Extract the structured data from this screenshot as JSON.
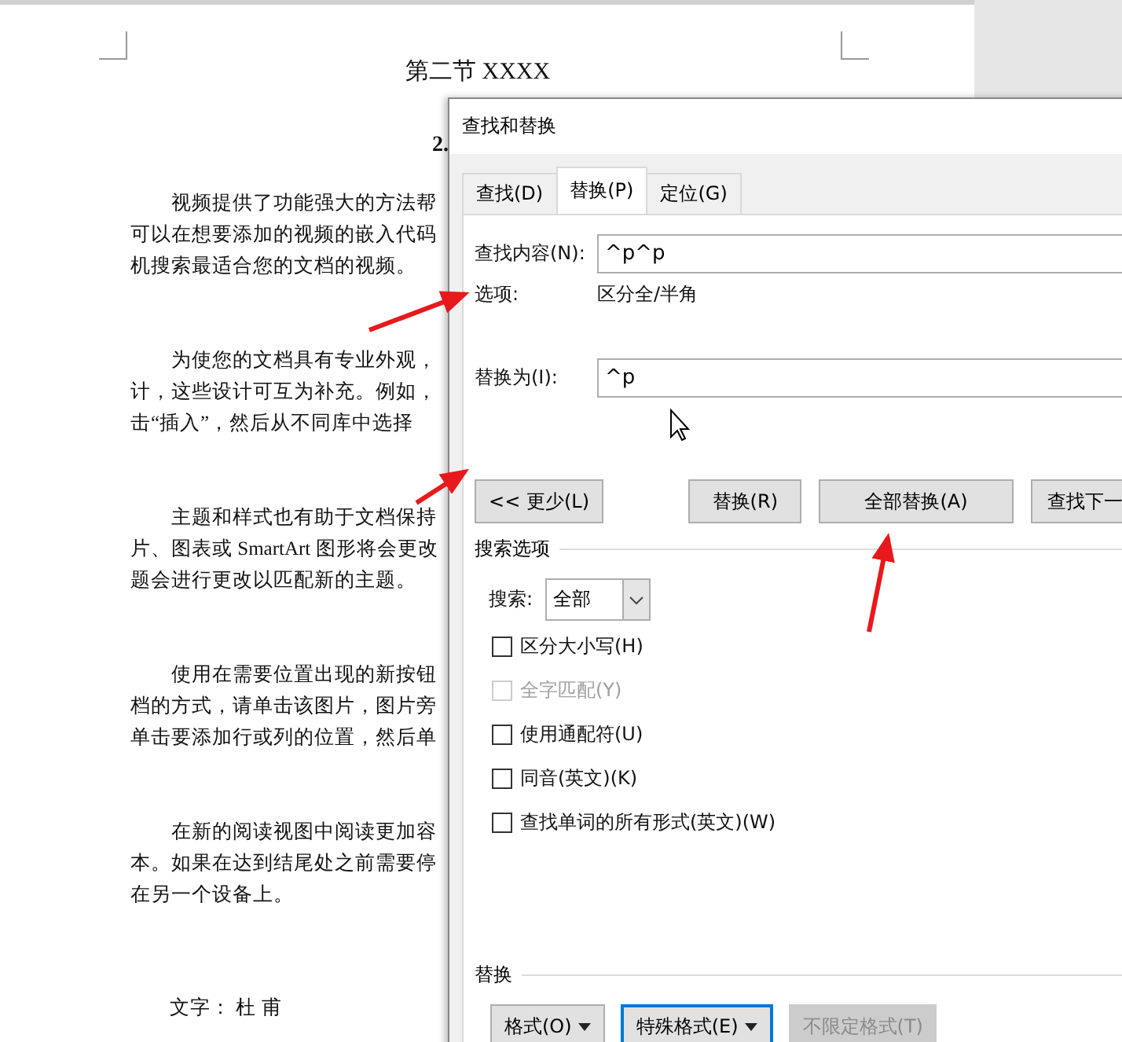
{
  "document": {
    "heading": "第二节  XXXX",
    "subheading": "2.",
    "paragraphs": [
      {
        "lines": [
          "视频提供了功能强大的方法帮",
          "可以在想要添加的视频的嵌入代码",
          "机搜索最适合您的文档的视频。"
        ]
      },
      {
        "lines": [
          "为使您的文档具有专业外观，",
          "计，这些设计可互为补充。例如，",
          "击“插入”，然后从不同库中选择"
        ]
      },
      {
        "lines": [
          "主题和样式也有助于文档保持",
          "片、图表或 SmartArt 图形将会更改",
          "题会进行更改以匹配新的主题。"
        ]
      },
      {
        "lines": [
          "使用在需要位置出现的新按钮",
          "档的方式，请单击该图片，图片旁",
          "单击要添加行或列的位置，然后单"
        ]
      },
      {
        "lines": [
          "在新的阅读视图中阅读更加容",
          "本。如果在达到结尾处之前需要停",
          "在另一个设备上。"
        ]
      }
    ],
    "signature": "文字：  杜      甫"
  },
  "dialog": {
    "title": "查找和替换",
    "tabs": [
      {
        "label": "查找(D)",
        "selected": false
      },
      {
        "label": "替换(P)",
        "selected": true
      },
      {
        "label": "定位(G)",
        "selected": false
      }
    ],
    "find_label": "查找内容(N):",
    "find_value": "^p^p",
    "options_label": "选项:",
    "options_value": "区分全/半角",
    "replace_label": "替换为(I):",
    "replace_value": "^p",
    "buttons": [
      "<< 更少(L)",
      "替换(R)",
      "全部替换(A)",
      "查找下一"
    ],
    "search_options_title": "搜索选项",
    "search_label": "搜索:",
    "search_value": "全部",
    "checkboxes": [
      {
        "label": "区分大小写(H)",
        "checked": false,
        "disabled": false
      },
      {
        "label": "全字匹配(Y)",
        "checked": false,
        "disabled": true
      },
      {
        "label": "使用通配符(U)",
        "checked": false,
        "disabled": false
      },
      {
        "label": "同音(英文)(K)",
        "checked": false,
        "disabled": false
      },
      {
        "label": "查找单词的所有形式(英文)(W)",
        "checked": false,
        "disabled": false
      }
    ],
    "replace_section_title": "替换",
    "bottom_buttons": [
      {
        "label": "格式(O)",
        "dropdown": true,
        "focused": false,
        "disabled": false
      },
      {
        "label": "特殊格式(E)",
        "dropdown": true,
        "focused": true,
        "disabled": false
      },
      {
        "label": "不限定格式(T)",
        "dropdown": false,
        "focused": false,
        "disabled": true
      }
    ]
  }
}
